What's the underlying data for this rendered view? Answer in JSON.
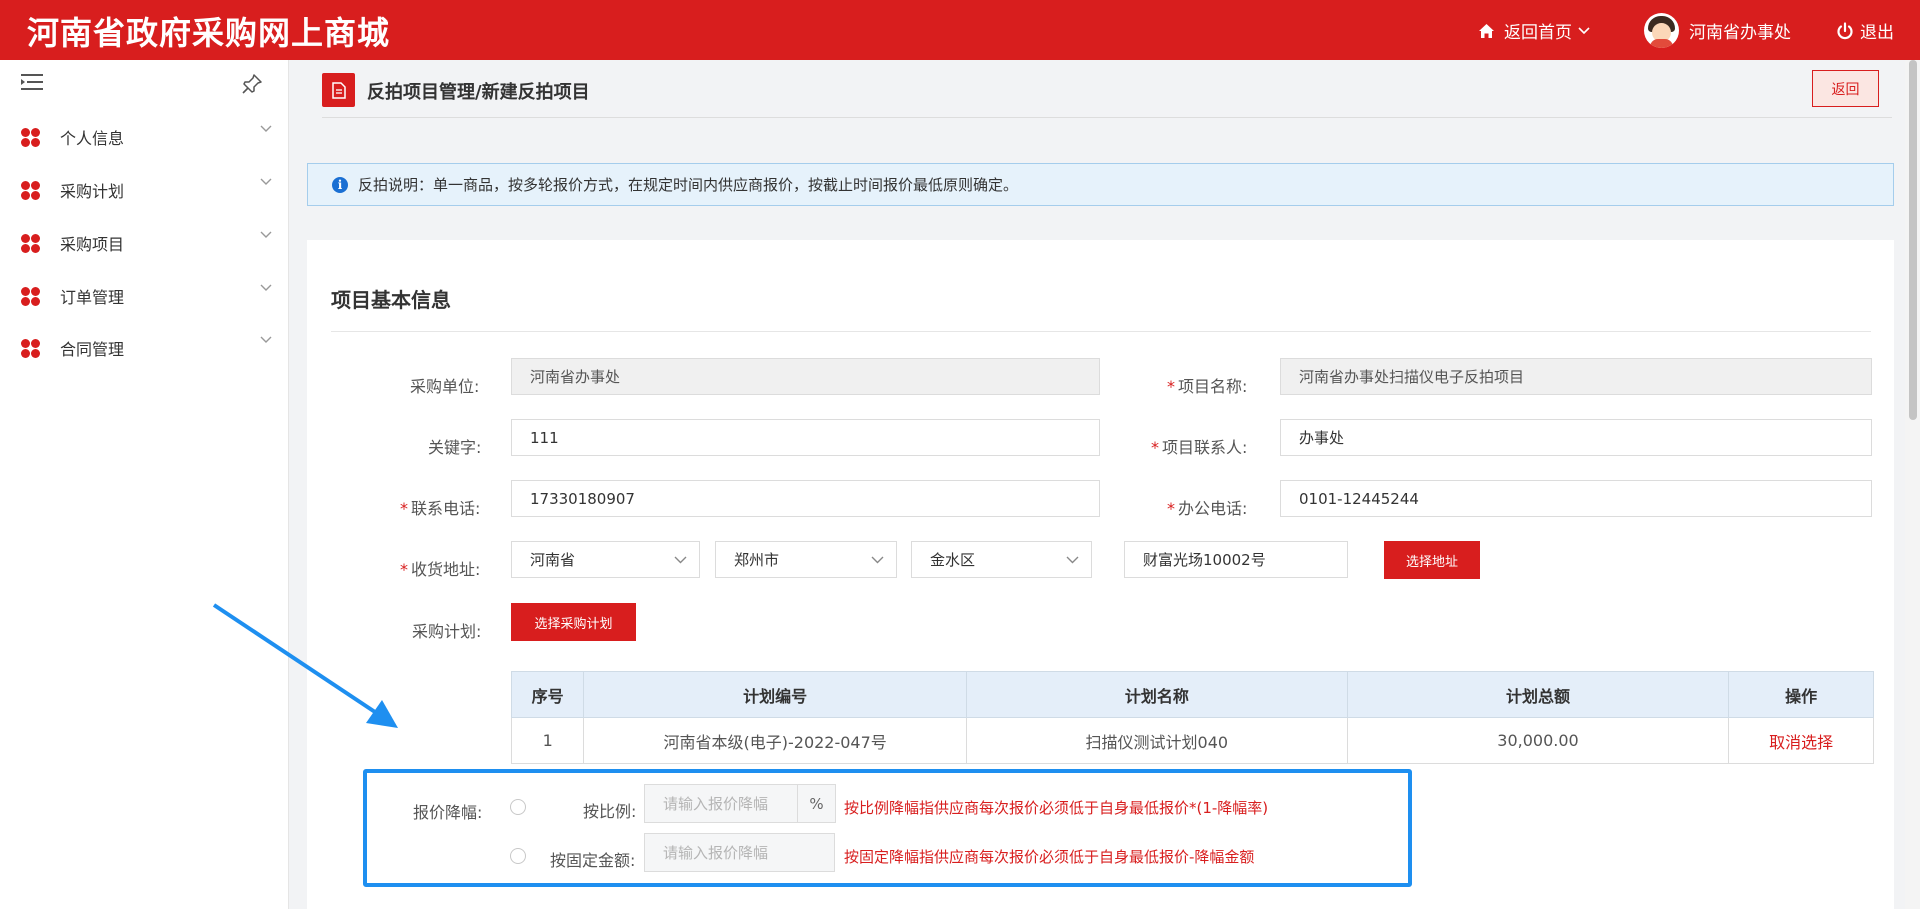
{
  "header": {
    "brand": "河南省政府采购网上商城",
    "home_label": "返回首页",
    "user_label": "河南省办事处",
    "logout_label": "退出"
  },
  "sidebar": {
    "items": [
      {
        "label": "个人信息"
      },
      {
        "label": "采购计划"
      },
      {
        "label": "采购项目"
      },
      {
        "label": "订单管理"
      },
      {
        "label": "合同管理"
      }
    ]
  },
  "page": {
    "title": "反拍项目管理/新建反拍项目",
    "back_label": "返回",
    "notice": "反拍说明：单一商品，按多轮报价方式，在规定时间内供应商报价，按截止时间报价最低原则确定。"
  },
  "form": {
    "section_title": "项目基本信息",
    "unit_label": "采购单位:",
    "unit_value": "河南省办事处",
    "project_name_label": "项目名称:",
    "project_name_value": "河南省办事处扫描仪电子反拍项目",
    "keyword_label": "关键字:",
    "keyword_value": "111",
    "contact_label": "项目联系人:",
    "contact_value": "办事处",
    "phone_label": "联系电话:",
    "phone_value": "17330180907",
    "office_phone_label": "办公电话:",
    "office_phone_value": "0101-12445244",
    "address_label": "收货地址:",
    "province": "河南省",
    "city": "郑州市",
    "district": "金水区",
    "street": "财富光场10002号",
    "select_address_label": "选择地址",
    "plan_label": "采购计划:",
    "select_plan_label": "选择采购计划",
    "required_mark": "*"
  },
  "plan_table": {
    "headers": [
      "序号",
      "计划编号",
      "计划名称",
      "计划总额",
      "操作"
    ],
    "rows": [
      {
        "no": "1",
        "code": "河南省本级(电子)-2022-047号",
        "name": "扫描仪测试计划040",
        "amount": "30,000.00",
        "action": "取消选择"
      }
    ]
  },
  "reduction": {
    "label": "报价降幅:",
    "ratio_label": "按比例:",
    "ratio_placeholder": "请输入报价降幅",
    "ratio_unit": "%",
    "ratio_hint": "按比例降幅指供应商每次报价必须低于自身最低报价*(1-降幅率)",
    "fixed_label": "按固定金额:",
    "fixed_placeholder": "请输入报价降幅",
    "fixed_hint": "按固定降幅指供应商每次报价必须低于自身最低报价-降幅金额"
  },
  "colors": {
    "brand_red": "#d81e1e",
    "highlight_blue": "#1e8ff0",
    "notice_bg": "#e6f2fb"
  }
}
